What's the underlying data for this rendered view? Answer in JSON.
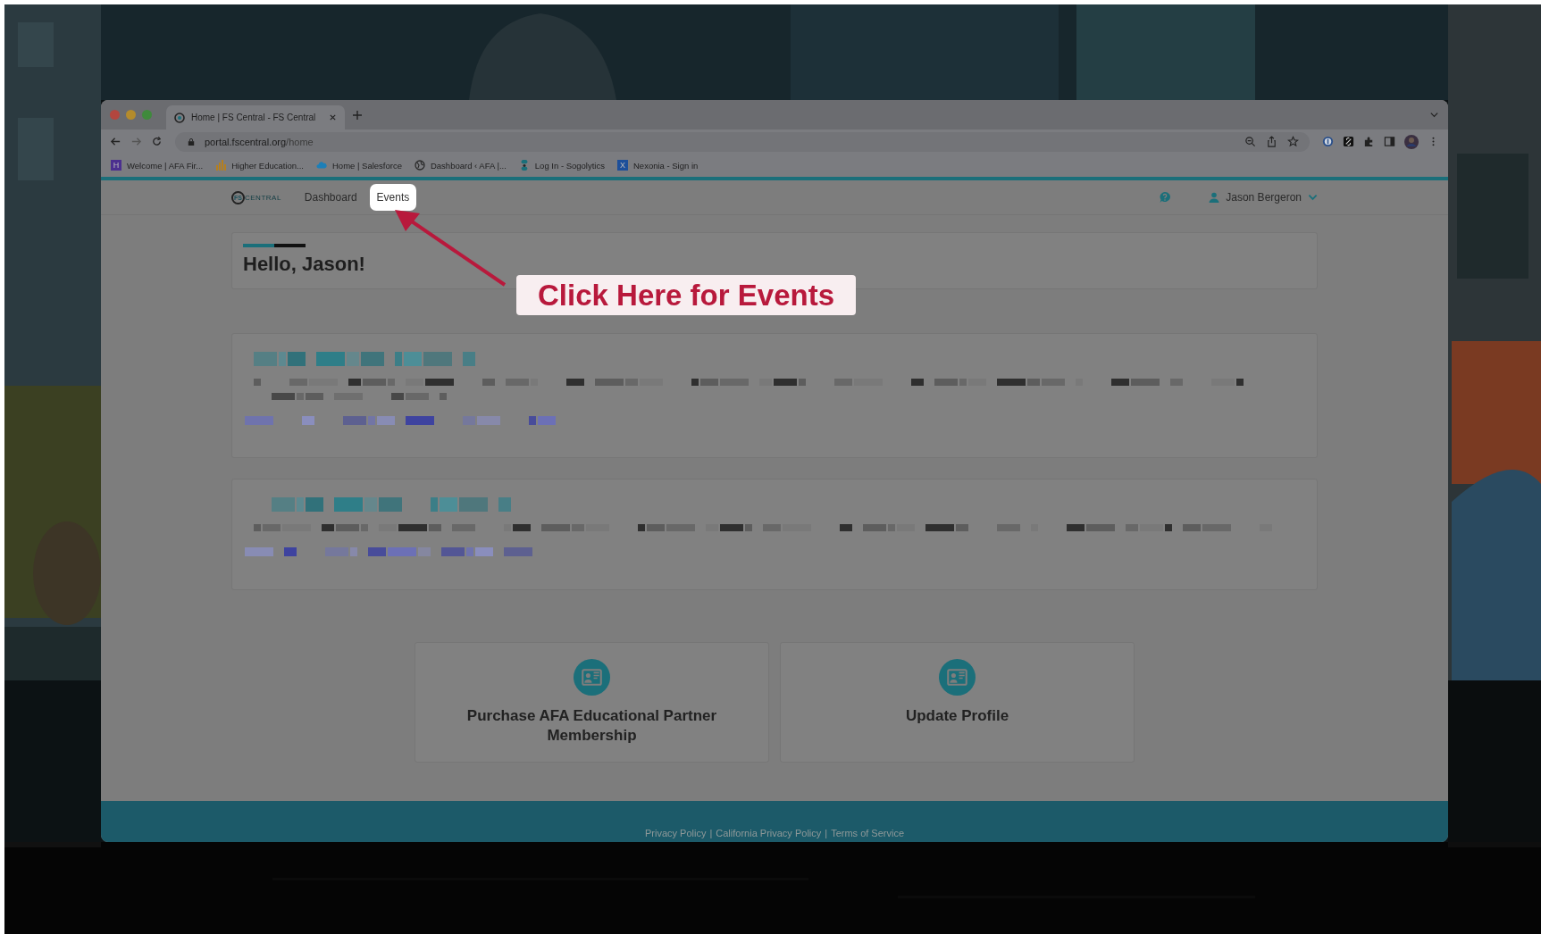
{
  "browser": {
    "tabs": [
      {
        "title": "Home | FS Central - FS Central",
        "selected": true
      }
    ],
    "address": {
      "host": "portal.fscentral.org",
      "path": "/home"
    },
    "bookmarks": [
      {
        "label": "Welcome | AFA Fir...",
        "kind": "letter",
        "badge": "H",
        "color": "#4b2f8f"
      },
      {
        "label": "Higher Education...",
        "kind": "bars",
        "color": "#b57f1e"
      },
      {
        "label": "Home | Salesforce",
        "kind": "cloud",
        "color": "#1c7fb8"
      },
      {
        "label": "Dashboard ‹ AFA |...",
        "kind": "globe",
        "color": "#2a2a2a"
      },
      {
        "label": "Log In - Sogolytics",
        "kind": "dots",
        "color": "#1a6f7a"
      },
      {
        "label": "Nexonia - Sign in",
        "kind": "letter",
        "badge": "X",
        "color": "#1d4f9a"
      }
    ]
  },
  "site": {
    "logo": {
      "mark": "FS",
      "text": "CENTRAL"
    },
    "nav": [
      {
        "label": "Dashboard",
        "selected": false
      },
      {
        "label": "Events",
        "selected": true
      }
    ],
    "user": {
      "name": "Jason Bergeron"
    },
    "greeting": "Hello, Jason!",
    "blurred_panels": [
      {
        "kind": "pixelated"
      },
      {
        "kind": "pixelated"
      }
    ],
    "actions": [
      {
        "label": "Purchase AFA Educational Partner Membership"
      },
      {
        "label": "Update Profile"
      }
    ],
    "footer": {
      "links": [
        "Privacy Policy",
        "California Privacy Policy",
        "Terms of Service"
      ],
      "separator": "|"
    }
  },
  "annotation": {
    "text": "Click Here for Events"
  }
}
